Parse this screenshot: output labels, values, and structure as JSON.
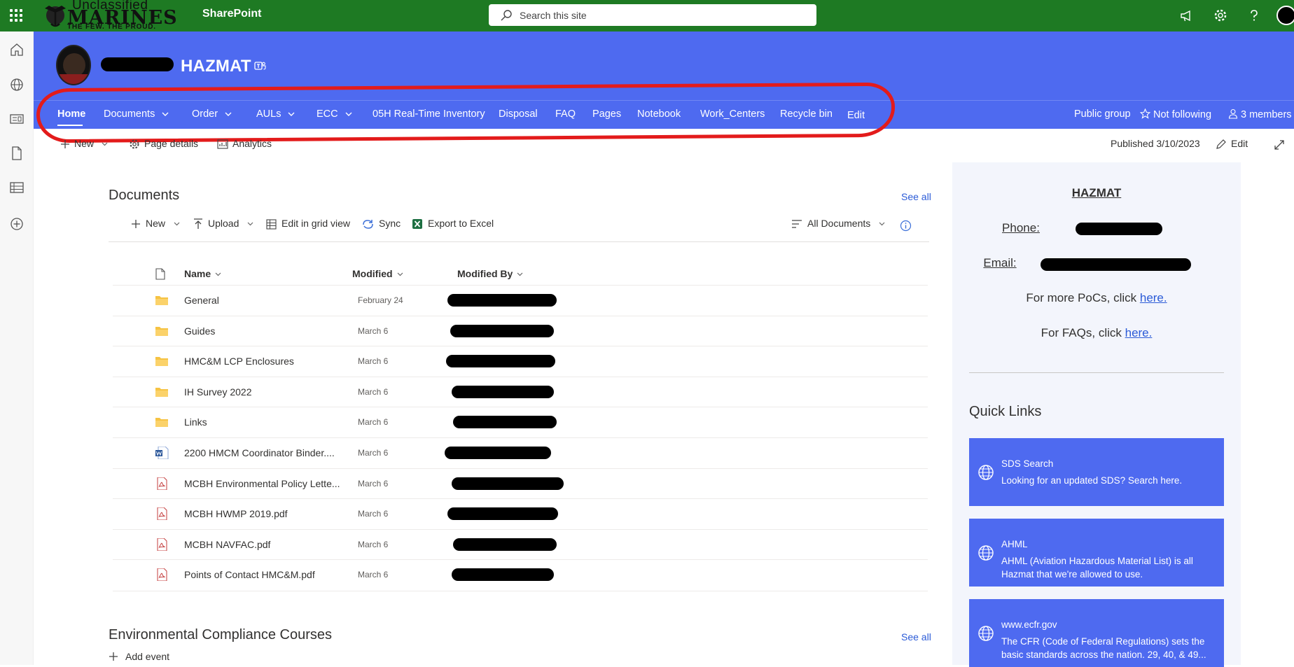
{
  "suitebar": {
    "logo_unclassified": "Unclassified",
    "logo_marines": "MARINES",
    "logo_tagline": "THE FEW. THE PROUD.",
    "app_name": "SharePoint",
    "search_placeholder": "Search this site"
  },
  "header": {
    "site_title": "HAZMAT",
    "nav": [
      {
        "label": "Home"
      },
      {
        "label": "Documents"
      },
      {
        "label": "Order"
      },
      {
        "label": "AULs"
      },
      {
        "label": "ECC"
      },
      {
        "label": "05H Real-Time Inventory"
      },
      {
        "label": "Disposal"
      },
      {
        "label": "FAQ"
      },
      {
        "label": "Pages"
      },
      {
        "label": "Notebook"
      },
      {
        "label": "Work_Centers"
      },
      {
        "label": "Recycle bin"
      },
      {
        "label": "Edit"
      }
    ],
    "public_group": "Public group",
    "following": "Not following",
    "members": "3 members"
  },
  "command_bar": {
    "new": "New",
    "page_details": "Page details",
    "analytics": "Analytics",
    "published": "Published 3/10/2023",
    "edit": "Edit"
  },
  "documents": {
    "title": "Documents",
    "see_all": "See all",
    "commands": {
      "new": "New",
      "upload": "Upload",
      "edit_grid": "Edit in grid view",
      "sync": "Sync",
      "export": "Export to Excel",
      "view": "All Documents"
    },
    "columns": {
      "name": "Name",
      "modified": "Modified",
      "modified_by": "Modified By"
    },
    "rows": [
      {
        "name": "General",
        "modified": "February 24",
        "type": "folder"
      },
      {
        "name": "Guides",
        "modified": "March 6",
        "type": "folder"
      },
      {
        "name": "HMC&M LCP Enclosures",
        "modified": "March 6",
        "type": "folder"
      },
      {
        "name": "IH Survey 2022",
        "modified": "March 6",
        "type": "folder"
      },
      {
        "name": "Links",
        "modified": "March 6",
        "type": "folder"
      },
      {
        "name": "2200 HMCM Coordinator Binder....",
        "modified": "March 6",
        "type": "word"
      },
      {
        "name": "MCBH Environmental Policy Lette...",
        "modified": "March 6",
        "type": "pdf"
      },
      {
        "name": "MCBH HWMP 2019.pdf",
        "modified": "March 6",
        "type": "pdf"
      },
      {
        "name": "MCBH NAVFAC.pdf",
        "modified": "March 6",
        "type": "pdf"
      },
      {
        "name": "Points of Contact HMC&M.pdf",
        "modified": "March 6",
        "type": "pdf"
      }
    ]
  },
  "courses": {
    "title": "Environmental Compliance Courses",
    "see_all": "See all",
    "add_event": "Add event"
  },
  "right_panel": {
    "heading": "HAZMAT",
    "phone_label": "Phone:",
    "email_label": "Email:",
    "pocs_text": "For more PoCs, click ",
    "pocs_link": "here.",
    "faqs_text": "For FAQs, click ",
    "faqs_link": "here.",
    "quick_links_title": "Quick Links",
    "quick_links": [
      {
        "title": "SDS Search",
        "desc": "Looking for an updated SDS? Search here."
      },
      {
        "title": "AHML",
        "desc": "AHML (Aviation Hazardous Material List) is all Hazmat that we're allowed to use."
      },
      {
        "title": "www.ecfr.gov",
        "desc": "The CFR (Code of Federal Regulations) sets the basic standards across the nation. 29, 40, & 49..."
      }
    ]
  },
  "colors": {
    "suitebar": "#1e7a23",
    "header": "#4e6af0",
    "link": "#2b5bd7",
    "annotation_ring": "#e31b1b"
  }
}
